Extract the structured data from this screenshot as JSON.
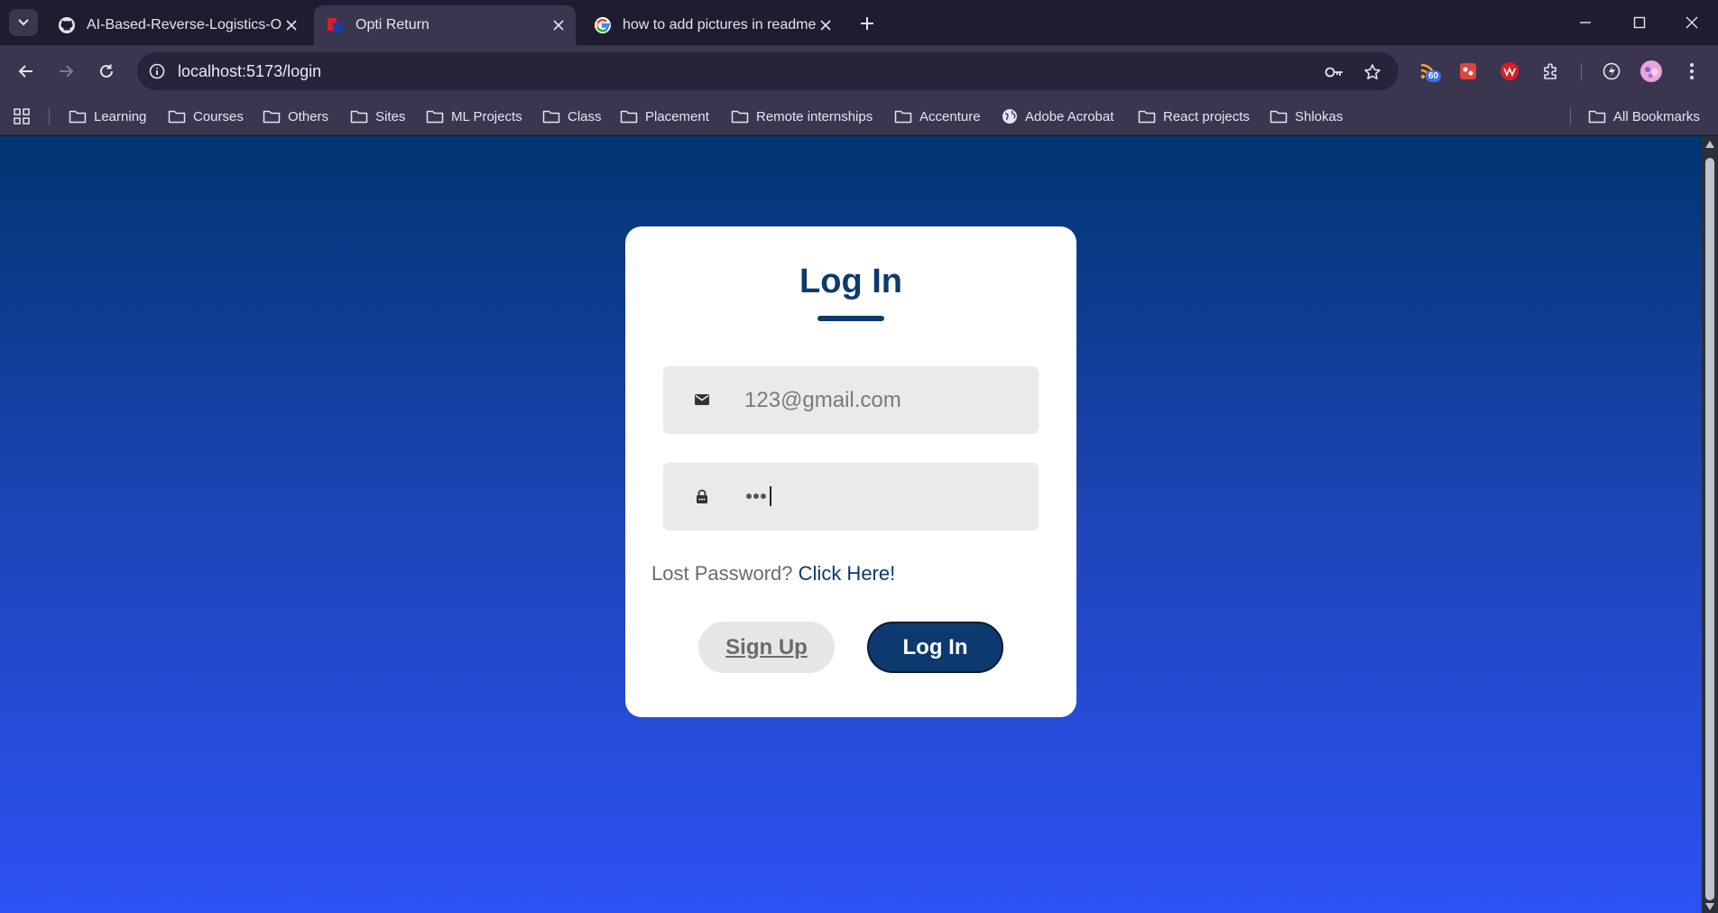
{
  "browser": {
    "tabs": [
      {
        "title": "AI-Based-Reverse-Logistics-Optimization",
        "favicon": "github-icon",
        "active": false
      },
      {
        "title": "Opti Return",
        "favicon": "opti-return-logo-icon",
        "active": true
      },
      {
        "title": "how to add pictures in readme",
        "favicon": "google-icon",
        "active": false
      }
    ],
    "url": "localhost:5173/login",
    "extension_badge": "60",
    "bookmarks": [
      {
        "label": "Learning"
      },
      {
        "label": "Courses"
      },
      {
        "label": "Others"
      },
      {
        "label": "Sites"
      },
      {
        "label": "ML Projects"
      },
      {
        "label": "Class"
      },
      {
        "label": "Placement"
      },
      {
        "label": "Remote internships"
      },
      {
        "label": "Accenture"
      },
      {
        "label": "Adobe Acrobat"
      },
      {
        "label": "React projects"
      },
      {
        "label": "Shlokas"
      }
    ],
    "all_bookmarks": "All Bookmarks"
  },
  "login": {
    "title": "Log In",
    "email_value": "123@gmail.com",
    "lost_password_text": "Lost Password?",
    "lost_password_link": "Click Here!",
    "signup_label": "Sign Up",
    "login_label": "Log In"
  },
  "colors": {
    "primary": "#0d3a6e",
    "gradient_top": "#003570",
    "gradient_bottom": "#2b52f4",
    "field_bg": "#eaeaea",
    "browser_chrome": "#3a3650"
  }
}
